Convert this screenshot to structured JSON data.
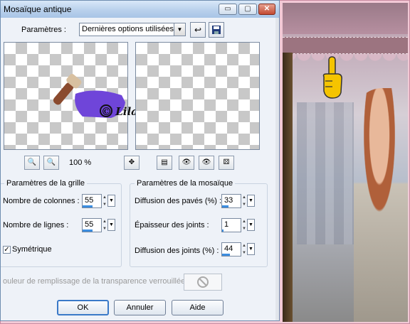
{
  "window": {
    "title": "Mosaïque antique",
    "controls": {
      "minimize": "▭",
      "maximize": "▢",
      "close": "✕"
    }
  },
  "params": {
    "label": "Paramètres :",
    "preset_value": "Dernières options utilisées"
  },
  "preview": {
    "watermark_text": "© Lila",
    "zoom_label": "100 %"
  },
  "grid_group": {
    "title": "Paramètres de la grille",
    "columns_label": "Nombre de colonnes :",
    "columns_value": "55",
    "columns_fraction": 0.55,
    "rows_label": "Nombre de lignes :",
    "rows_value": "55",
    "rows_fraction": 0.55,
    "symmetric_label": "Symétrique",
    "symmetric_checked": true
  },
  "mosaic_group": {
    "title": "Paramètres de la mosaïque",
    "tile_diffusion_label": "Diffusion des pavés (%) :",
    "tile_diffusion_value": "33",
    "tile_diffusion_fraction": 0.33,
    "joint_thickness_label": "Épaisseur des joints :",
    "joint_thickness_value": "1",
    "joint_thickness_fraction": 0.05,
    "joint_diffusion_label": "Diffusion des joints (%) :",
    "joint_diffusion_value": "44",
    "joint_diffusion_fraction": 0.44
  },
  "fill_label": "ouleur de remplissage de la transparence verrouillée :",
  "buttons": {
    "ok": "OK",
    "cancel": "Annuler",
    "help": "Aide"
  },
  "colors": {
    "accent": "#3a79c8",
    "titlebar": "#b9d1ec",
    "background": "#f3c9d6"
  }
}
